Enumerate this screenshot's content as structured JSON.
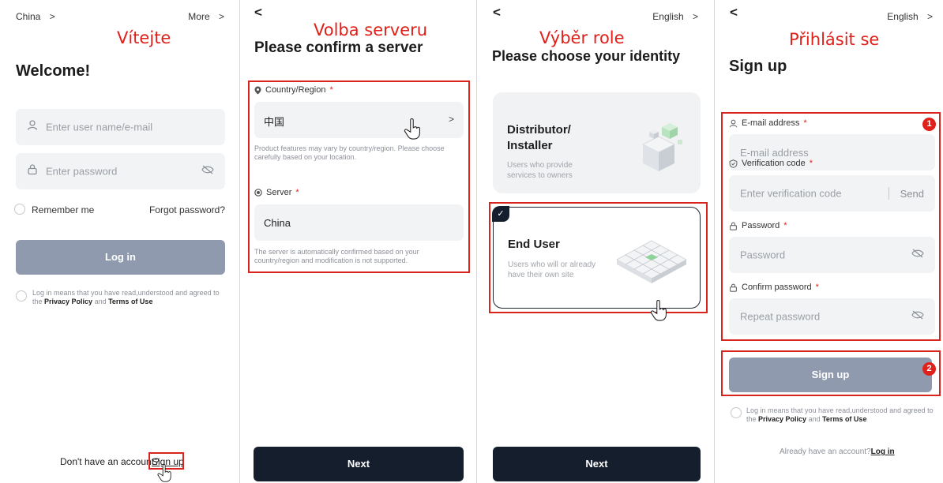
{
  "panel1": {
    "region": "China",
    "region_chevron": ">",
    "more": "More",
    "more_chevron": ">",
    "cz_title": "Vítejte",
    "heading": "Welcome!",
    "username_placeholder": "Enter user name/e-mail",
    "password_placeholder": "Enter password",
    "remember_me": "Remember me",
    "forgot_password": "Forgot password?",
    "login_button": "Log in",
    "agree_prefix": "Log in means that you have read,understood and agreed to the ",
    "privacy_policy": "Privacy Policy",
    "and": " and ",
    "terms": "Terms of Use",
    "no_account": "Don't have an account?",
    "sign_up_link": "Sign up"
  },
  "panel2": {
    "back": "<",
    "cz_title": "Volba serveru",
    "heading": "Please confirm a server",
    "country_label": "Country/Region",
    "required": "*",
    "country_value": "中国",
    "country_chevron": ">",
    "country_hint": "Product features may vary by country/region. Please choose carefully based on your location.",
    "server_label": "Server",
    "server_value": "China",
    "server_hint": "The server is automatically confirmed based on your country/region and modification is not supported.",
    "next_button": "Next"
  },
  "panel3": {
    "back": "<",
    "language": "English",
    "language_chevron": ">",
    "cz_title": "Výběr role",
    "heading": "Please choose your identity",
    "distributor_title_1": "Distributor/",
    "distributor_title_2": "Installer",
    "distributor_desc_1": "Users who provide",
    "distributor_desc_2": "services to owners",
    "end_user_title": "End User",
    "end_user_desc_1": "Users who will or already",
    "end_user_desc_2": "have their own site",
    "next_button": "Next"
  },
  "panel4": {
    "back": "<",
    "language": "English",
    "language_chevron": ">",
    "cz_title": "Přihlásit se",
    "heading": "Sign up",
    "email_label": "E-mail address",
    "required": "*",
    "email_placeholder": "E-mail address",
    "code_label": "Verification code",
    "code_placeholder": "Enter verification code",
    "send": "Send",
    "password_label": "Password",
    "password_placeholder": "Password",
    "confirm_label": "Confirm password",
    "confirm_placeholder": "Repeat password",
    "signup_button": "Sign up",
    "badge_1": "1",
    "badge_2": "2",
    "agree_prefix": "Log in means that you have read,understood and agreed to the ",
    "privacy_policy": "Privacy Policy",
    "and": " and ",
    "terms": "Terms of Use",
    "have_account": "Already have an account?",
    "login_link": "Log in"
  },
  "colors": {
    "annotation_red": "#e0201a",
    "button_grey": "#8f9aae",
    "button_dark": "#141e2d",
    "field_bg": "#f2f3f5"
  }
}
